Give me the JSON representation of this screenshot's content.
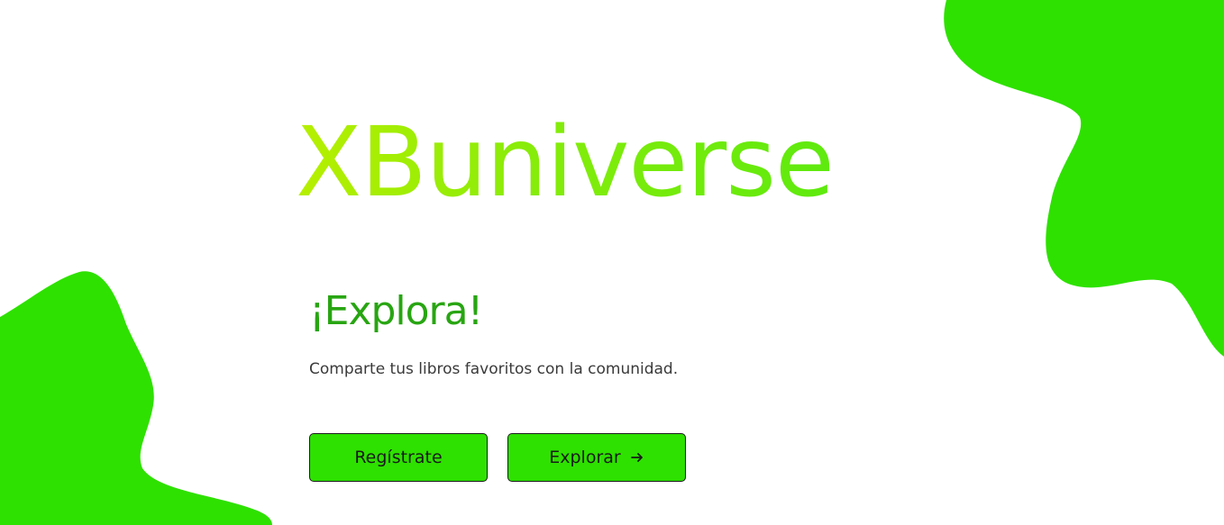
{
  "brand": {
    "title": "XBuniverse"
  },
  "hero": {
    "headline": "¡Explora!",
    "subtitle": "Comparte tus libros favoritos con la comunidad."
  },
  "actions": {
    "register_label": "Regístrate",
    "explore_label": "Explorar",
    "explore_icon": "arrow-right-icon"
  },
  "colors": {
    "accent_green": "#2ee100",
    "headline_green": "#28a512",
    "brand_gradient_start": "#b7ef00",
    "brand_gradient_end": "#5eea0e"
  }
}
